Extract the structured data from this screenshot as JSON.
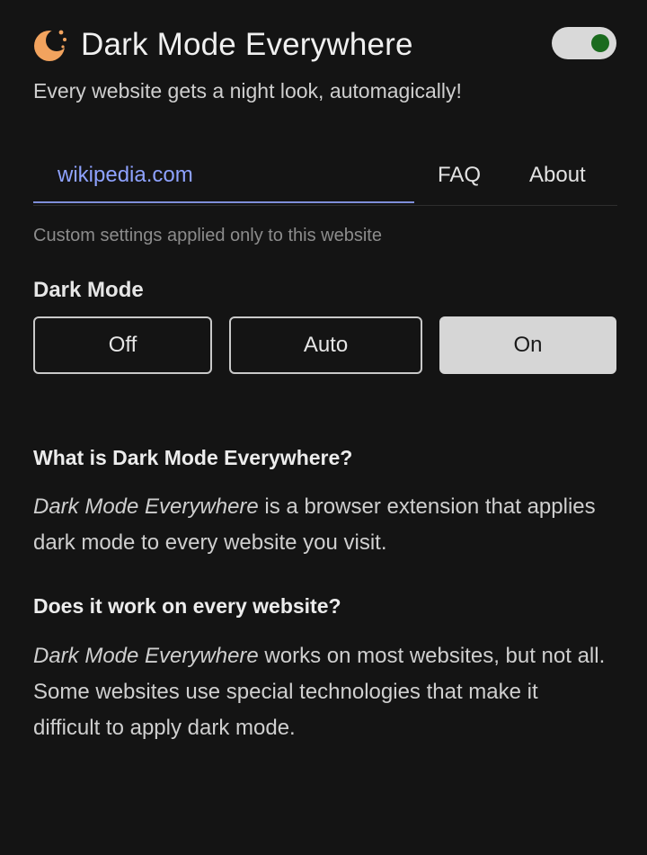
{
  "header": {
    "logo_icon": "moon-sun-icon",
    "title": "Dark Mode Everywhere",
    "toggle_state": "on",
    "toggle_color": "#1a6b1e",
    "logo_color": "#f2a35e"
  },
  "subtitle": "Every website gets a night look, automagically!",
  "tabs": [
    {
      "label": "wikipedia.com",
      "active": true
    },
    {
      "label": "FAQ",
      "active": false
    },
    {
      "label": "About",
      "active": false
    }
  ],
  "hint": "Custom settings applied only to this website",
  "dark_mode": {
    "label": "Dark Mode",
    "options": [
      "Off",
      "Auto",
      "On"
    ],
    "selected": "On"
  },
  "faq": [
    {
      "question": "What is Dark Mode Everywhere?",
      "answer_emphasis": "Dark Mode Everywhere",
      "answer_rest": " is a browser extension that applies dark mode to every website you visit."
    },
    {
      "question": "Does it work on every website?",
      "answer_emphasis": "Dark Mode Everywhere",
      "answer_rest": " works on most websites, but not all. Some websites use special technologies that make it difficult to apply dark mode."
    }
  ],
  "colors": {
    "background": "#141414",
    "accent": "#8ea2ff"
  }
}
